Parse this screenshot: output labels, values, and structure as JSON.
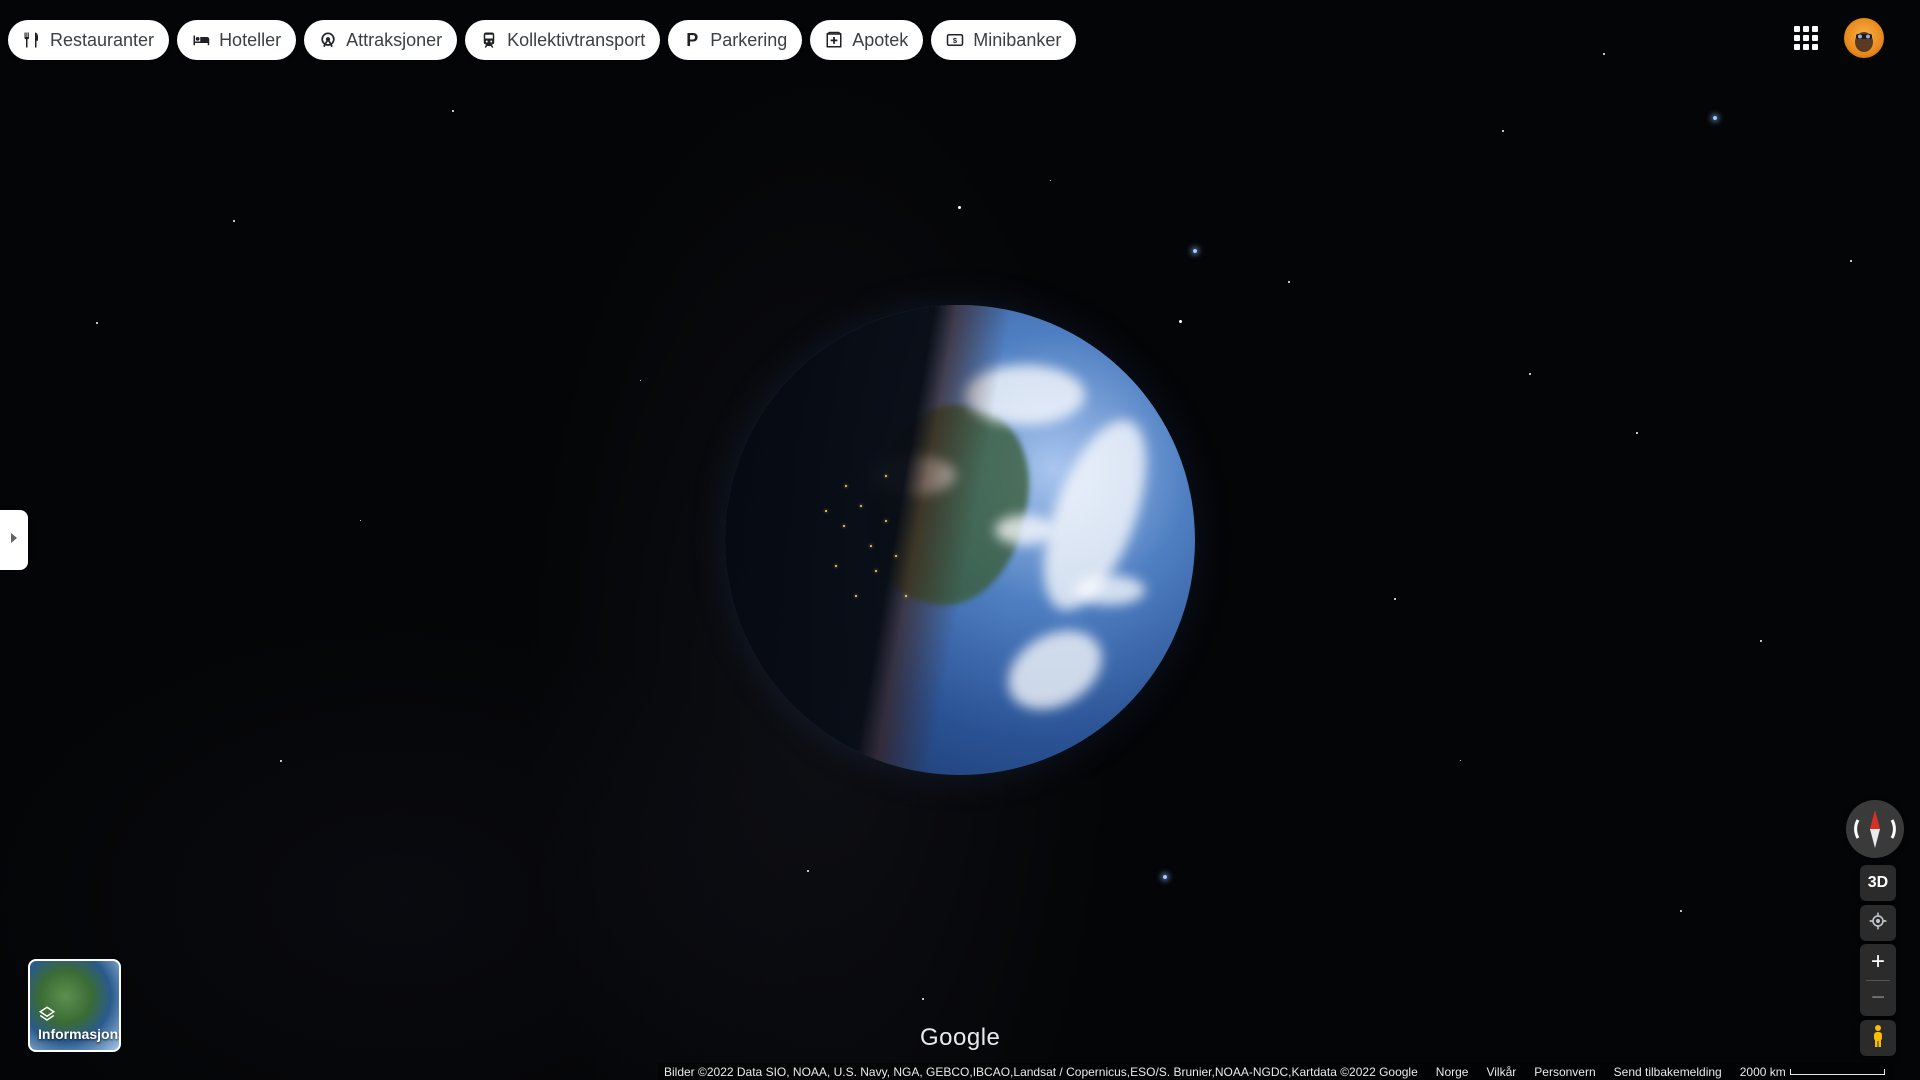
{
  "chips": [
    {
      "label": "Restauranter",
      "icon": "fork-knife-icon"
    },
    {
      "label": "Hoteller",
      "icon": "bed-icon"
    },
    {
      "label": "Attraksjoner",
      "icon": "attraction-icon"
    },
    {
      "label": "Kollektivtransport",
      "icon": "train-icon"
    },
    {
      "label": "Parkering",
      "icon": "parking-icon"
    },
    {
      "label": "Apotek",
      "icon": "pharmacy-icon"
    },
    {
      "label": "Minibanker",
      "icon": "atm-icon"
    }
  ],
  "layers": {
    "label": "Informasjonslag"
  },
  "controls": {
    "three_d": "3D",
    "zoom_in": "+",
    "zoom_out": "−"
  },
  "logo": "Google",
  "footer": {
    "attribution": "Bilder ©2022 Data SIO, NOAA, U.S. Navy, NGA, GEBCO,IBCAO,Landsat / Copernicus,ESO/S. Brunier,NOAA-NGDC,Kartdata ©2022 Google",
    "country": "Norge",
    "terms": "Vilkår",
    "privacy": "Personvern",
    "feedback": "Send tilbakemelding",
    "scale": "2000 km"
  },
  "colors": {
    "space": "#040507",
    "chip_bg": "#ffffff",
    "control_bg": "#2b2b2b",
    "compass_north": "#d93025"
  }
}
